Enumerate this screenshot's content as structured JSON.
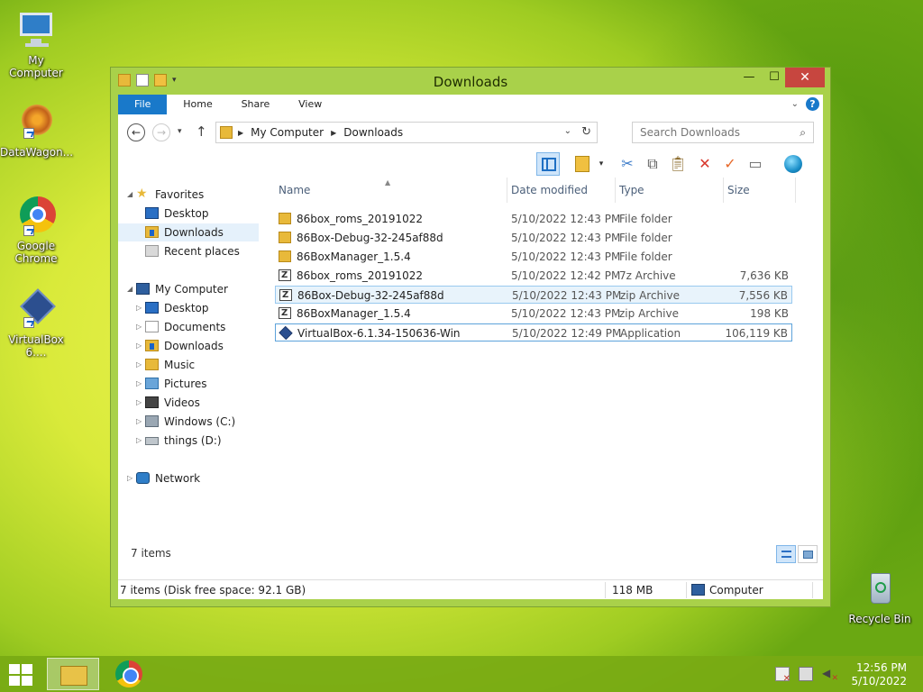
{
  "desktop": {
    "icons": [
      {
        "label": "My Computer"
      },
      {
        "label": "DataWagon..."
      },
      {
        "label": "Google Chrome"
      },
      {
        "label": "VirtualBox 6...."
      },
      {
        "label": "Recycle Bin"
      }
    ]
  },
  "window": {
    "title": "Downloads",
    "ribbon": {
      "tabs": [
        "File",
        "Home",
        "Share",
        "View"
      ]
    },
    "address": {
      "crumbs": [
        "My Computer",
        "Downloads"
      ]
    },
    "search": {
      "placeholder": "Search Downloads"
    },
    "nav": {
      "favorites": "Favorites",
      "fav_items": [
        "Desktop",
        "Downloads",
        "Recent places"
      ],
      "computer": "My Computer",
      "pc_items": [
        "Desktop",
        "Documents",
        "Downloads",
        "Music",
        "Pictures",
        "Videos",
        "Windows (C:)",
        "things (D:)"
      ],
      "network": "Network"
    },
    "columns": {
      "name": "Name",
      "date": "Date modified",
      "type": "Type",
      "size": "Size"
    },
    "files": [
      {
        "name": "86box_roms_20191022",
        "date": "5/10/2022 12:43 PM",
        "type": "File folder",
        "size": "",
        "icon": "folder-icon"
      },
      {
        "name": "86Box-Debug-32-245af88d",
        "date": "5/10/2022 12:43 PM",
        "type": "File folder",
        "size": "",
        "icon": "folder-icon"
      },
      {
        "name": "86BoxManager_1.5.4",
        "date": "5/10/2022 12:43 PM",
        "type": "File folder",
        "size": "",
        "icon": "folder-icon"
      },
      {
        "name": "86box_roms_20191022",
        "date": "5/10/2022 12:42 PM",
        "type": "7z Archive",
        "size": "7,636 KB",
        "icon": "archive-icon"
      },
      {
        "name": "86Box-Debug-32-245af88d",
        "date": "5/10/2022 12:43 PM",
        "type": "zip Archive",
        "size": "7,556 KB",
        "icon": "archive-icon"
      },
      {
        "name": "86BoxManager_1.5.4",
        "date": "5/10/2022 12:43 PM",
        "type": "zip Archive",
        "size": "198 KB",
        "icon": "archive-icon"
      },
      {
        "name": "VirtualBox-6.1.34-150636-Win",
        "date": "5/10/2022 12:49 PM",
        "type": "Application",
        "size": "106,119 KB",
        "icon": "virtualbox-icon"
      }
    ],
    "item_count": "7 items",
    "status": {
      "left": "7 items (Disk free space: 92.1 GB)",
      "size": "118 MB",
      "location": "Computer"
    }
  },
  "taskbar": {
    "time": "12:56 PM",
    "date": "5/10/2022"
  },
  "colors": {
    "window_frame": "#a9d14a",
    "accent": "#1979ca",
    "close": "#c7463f",
    "selection": "#e8f3fb"
  }
}
